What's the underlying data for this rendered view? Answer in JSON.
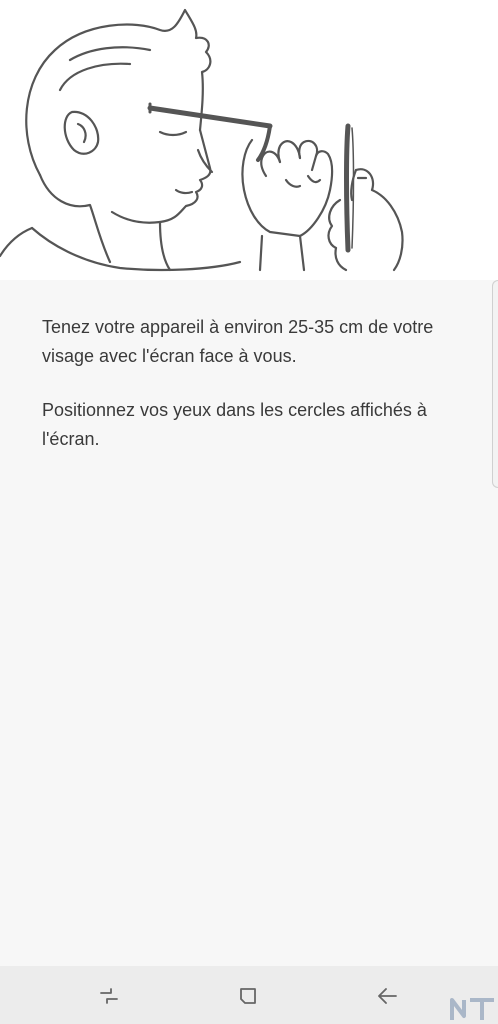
{
  "instructions": {
    "paragraph_1": "Tenez votre appareil à environ 25-35 cm de votre visage avec l'écran face à vous.",
    "paragraph_2": "Positionnez vos yeux dans les cercles affichés à l'écran."
  },
  "illustration": {
    "icon": "person-holding-phone-illustration"
  },
  "navbar": {
    "recent_icon": "recent-apps-icon",
    "home_icon": "home-icon",
    "back_icon": "back-icon"
  },
  "colors": {
    "content_background": "#f7f7f7",
    "illustration_background": "#ffffff",
    "text": "#3a3a3a",
    "navbar": "#ececec",
    "line_art": "#555555"
  }
}
